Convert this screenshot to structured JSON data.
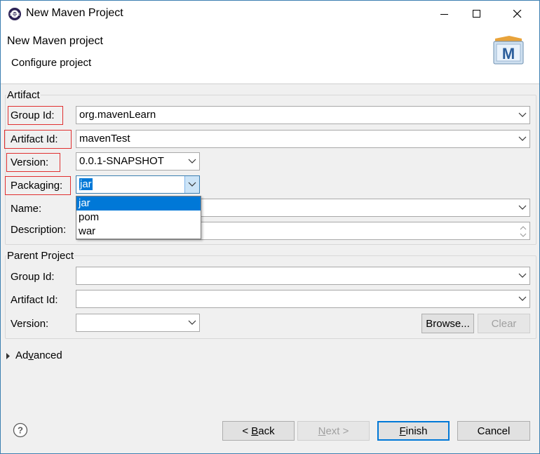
{
  "window": {
    "title": "New Maven Project"
  },
  "header": {
    "title": "New Maven project",
    "subtitle": "Configure project"
  },
  "artifact": {
    "legend": "Artifact",
    "group_id": {
      "label": "Group Id:",
      "value": "org.mavenLearn"
    },
    "artifact_id": {
      "label": "Artifact Id:",
      "value": "mavenTest"
    },
    "version": {
      "label": "Version:",
      "value": "0.0.1-SNAPSHOT"
    },
    "packaging": {
      "label": "Packaging:",
      "value": "jar",
      "options": [
        "jar",
        "pom",
        "war"
      ]
    },
    "name": {
      "label": "Name:",
      "value": ""
    },
    "description": {
      "label": "Description:",
      "value": ""
    }
  },
  "parent": {
    "legend": "Parent Project",
    "group_id": {
      "label": "Group Id:",
      "value": ""
    },
    "artifact_id": {
      "label": "Artifact Id:",
      "value": ""
    },
    "version": {
      "label": "Version:",
      "value": ""
    },
    "browse_label": "Browse...",
    "clear_label": "Clear"
  },
  "advanced": {
    "label_pre": "Ad",
    "label_u": "v",
    "label_post": "anced"
  },
  "footer": {
    "back_pre": "< ",
    "back_u": "B",
    "back_post": "ack",
    "next_u": "N",
    "next_post": "ext >",
    "finish_u": "F",
    "finish_post": "inish",
    "cancel": "Cancel"
  },
  "colors": {
    "accent": "#0078d7",
    "highlight_border": "#e03030"
  },
  "icons": {
    "app": "eclipse-icon",
    "logo": "maven-m-icon",
    "help": "help-icon"
  }
}
